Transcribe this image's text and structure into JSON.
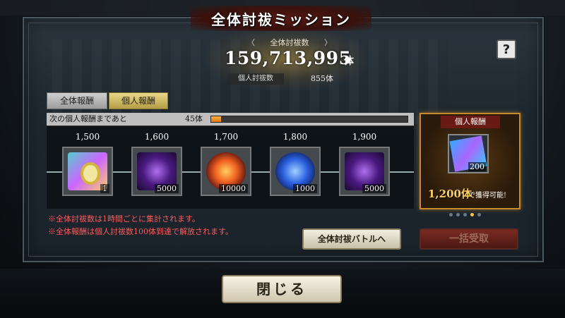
{
  "title": "全体討⁠祓ミッション",
  "total": {
    "label": "全体討祓数",
    "count": "159,713,995",
    "unit": "体"
  },
  "personal": {
    "label": "個人討祓数",
    "count": "855体"
  },
  "help_label": "?",
  "tabs": {
    "all": "全体報酬",
    "personal": "個人報酬"
  },
  "progress": {
    "label": "次の個人報酬まであと",
    "remaining": "45体",
    "fraction": 0.05
  },
  "rewards": [
    {
      "threshold": "1,500",
      "qty": "1",
      "icon": "medal-icon"
    },
    {
      "threshold": "1,600",
      "qty": "5000",
      "icon": "purple-crystal-icon"
    },
    {
      "threshold": "1,700",
      "qty": "10000",
      "icon": "fire-orb-icon"
    },
    {
      "threshold": "1,800",
      "qty": "1000",
      "icon": "blue-orb-icon"
    },
    {
      "threshold": "1,900",
      "qty": "5000",
      "icon": "purple-crystal-icon"
    }
  ],
  "side": {
    "header": "個人報酬",
    "qty": "200",
    "icon": "cube-icon",
    "count": "1,200体",
    "suffix": "で獲得可能!"
  },
  "pagination": {
    "total": 5,
    "active": 3
  },
  "notes": [
    "※全体討祓数は1時間ごとに集計されます。",
    "※全体報酬は個人討祓数100体到達で解放されます。"
  ],
  "buttons": {
    "battle": "全体討祓バトルへ",
    "receive": "一括受取",
    "close": "閉じる"
  },
  "colors": {
    "accent_orange": "#e07810",
    "note_red": "#ff5a5a",
    "title_red": "#5a1b14"
  }
}
